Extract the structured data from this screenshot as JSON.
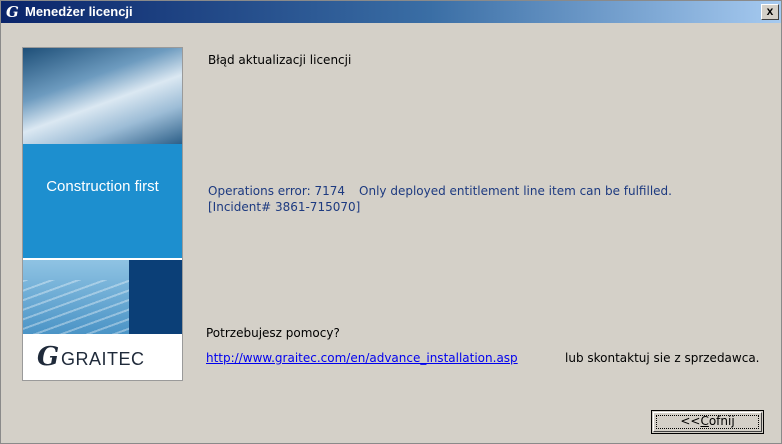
{
  "window": {
    "title": "Menedżer licencji",
    "close_glyph": "x"
  },
  "titlebar": {
    "logo_glyph": "G"
  },
  "sidebar": {
    "tagline": "Construction first",
    "logo_mark": "G",
    "logo_text": "GRAITEC"
  },
  "main": {
    "heading": "Błąd aktualizacji licencji",
    "error_prefix": "Operations error: 7174",
    "error_message": "Only deployed entitlement line item can be fulfilled.",
    "incident": "[Incident# 3861-715070]",
    "help_label": "Potrzebujesz pomocy?",
    "help_link": "http://www.graitec.com/en/advance_installation.asp",
    "contact_text": "lub skontaktuj sie z sprzedawca."
  },
  "buttons": {
    "back_prefix": "<<",
    "back_mnemonic": "C",
    "back_rest": "ofnij"
  },
  "colors": {
    "title_start": "#0a246a",
    "title_end": "#a6caf0",
    "accent_blue": "#1d8fcf",
    "error_text": "#1d3a80",
    "link": "#0000ee"
  }
}
